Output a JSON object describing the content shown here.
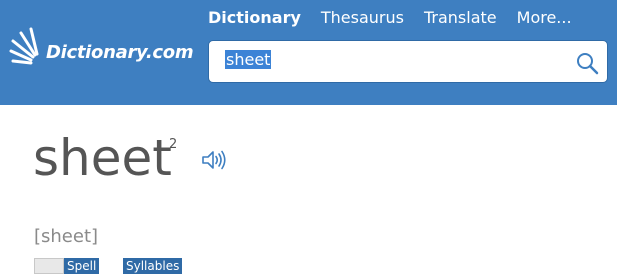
{
  "header": {
    "logo_text": "Dictionary.com",
    "nav": [
      "Dictionary",
      "Thesaurus",
      "Translate",
      "More..."
    ],
    "search": {
      "value": "sheet"
    }
  },
  "entry": {
    "headword": "sheet",
    "superscript": "2",
    "pronunciation": "[sheet]",
    "spell_label": "Spell",
    "syllables_label": "Syllables"
  },
  "colors": {
    "header_bg": "#3e7fc1",
    "selection": "#3c83d6",
    "headword": "#555555",
    "pronunciation": "#8a8a8a"
  },
  "icons": [
    "logo-sunburst-icon",
    "search-icon",
    "audio-icon"
  ]
}
